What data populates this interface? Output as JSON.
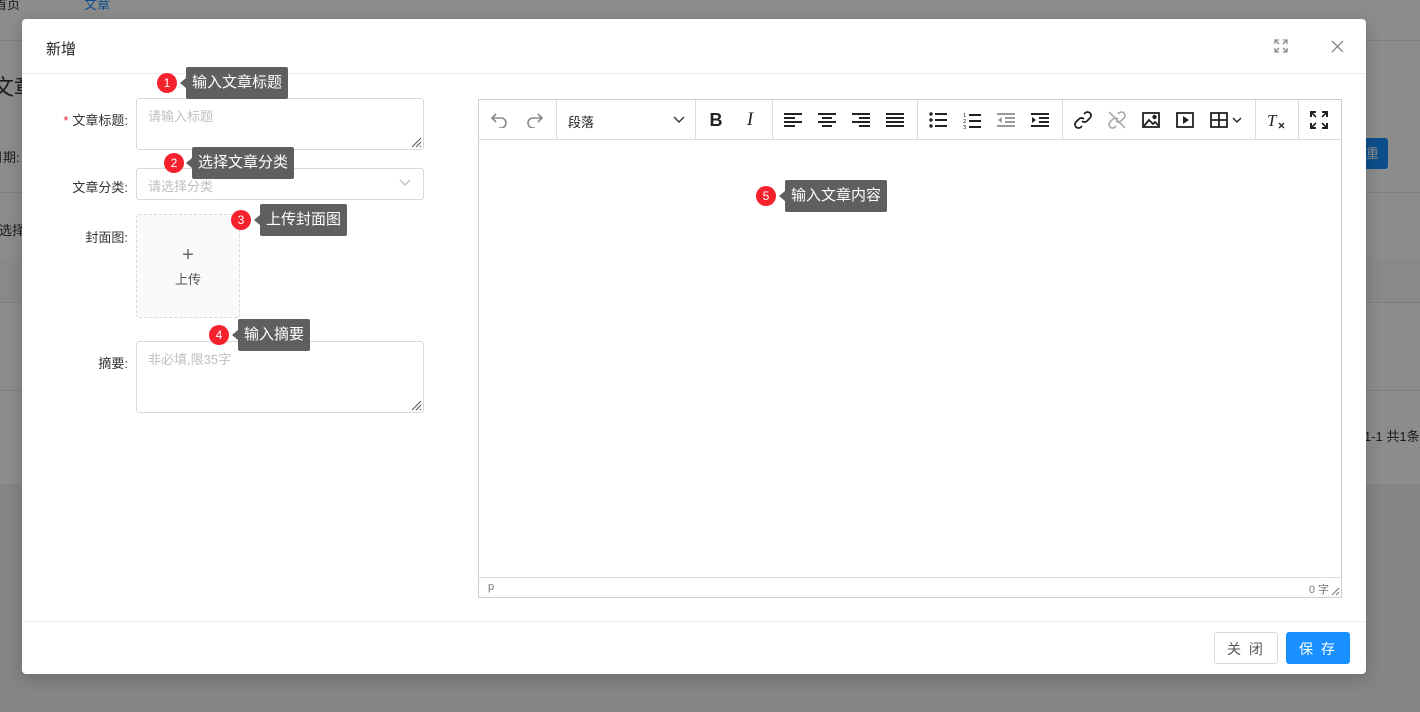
{
  "background": {
    "nav_home": "首页",
    "nav_article": "文章",
    "heading": "文章",
    "date_label": "日期:",
    "selected_text": "已选择",
    "reset_button": "重置",
    "pagination": "1-1 共1条"
  },
  "modal": {
    "title": "新增",
    "fullscreen_icon": "fullscreen-icon",
    "close_icon": "close-icon",
    "form": {
      "title_label": "文章标题:",
      "title_placeholder": "请输入标题",
      "category_label": "文章分类:",
      "category_placeholder": "请选择分类",
      "cover_label": "封面图:",
      "upload_text": "上传",
      "summary_label": "摘要:",
      "summary_placeholder": "非必填,限35字"
    },
    "editor": {
      "paragraph_select": "段落",
      "toolbar_icons": [
        "undo-icon",
        "redo-icon",
        "bold-icon",
        "italic-icon",
        "align-left-icon",
        "align-center-icon",
        "align-right-icon",
        "justify-icon",
        "bullet-list-icon",
        "numbered-list-icon",
        "outdent-icon",
        "indent-icon",
        "link-icon",
        "unlink-icon",
        "image-icon",
        "media-icon",
        "table-icon",
        "clear-format-icon",
        "fullscreen-icon"
      ],
      "status_path": "p",
      "word_count": "0 字"
    },
    "footer": {
      "close_label": "关 闭",
      "save_label": "保 存"
    }
  },
  "annotations": [
    {
      "number": "1",
      "text": "输入文章标题"
    },
    {
      "number": "2",
      "text": "选择文章分类"
    },
    {
      "number": "3",
      "text": "上传封面图"
    },
    {
      "number": "4",
      "text": "输入摘要"
    },
    {
      "number": "5",
      "text": "输入文章内容"
    }
  ],
  "colors": {
    "primary": "#1890ff",
    "required": "#f5222d",
    "annotation_badge": "#f5222d",
    "annotation_tooltip": "#5f5f5f",
    "overlay": "#8c8c8c"
  }
}
